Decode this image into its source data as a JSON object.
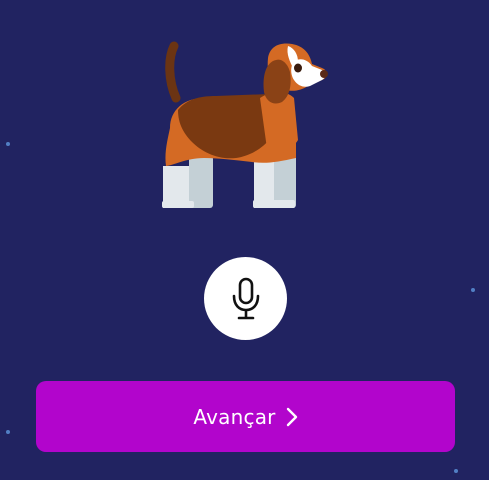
{
  "illustration": {
    "subject": "dog-icon"
  },
  "mic": {
    "icon": "microphone-icon"
  },
  "next_button": {
    "label": "Avançar",
    "icon": "chevron-right-icon"
  },
  "colors": {
    "background": "#212361",
    "button": "#b205cc",
    "mic_background": "#ffffff",
    "star": "#5b8fd6"
  }
}
